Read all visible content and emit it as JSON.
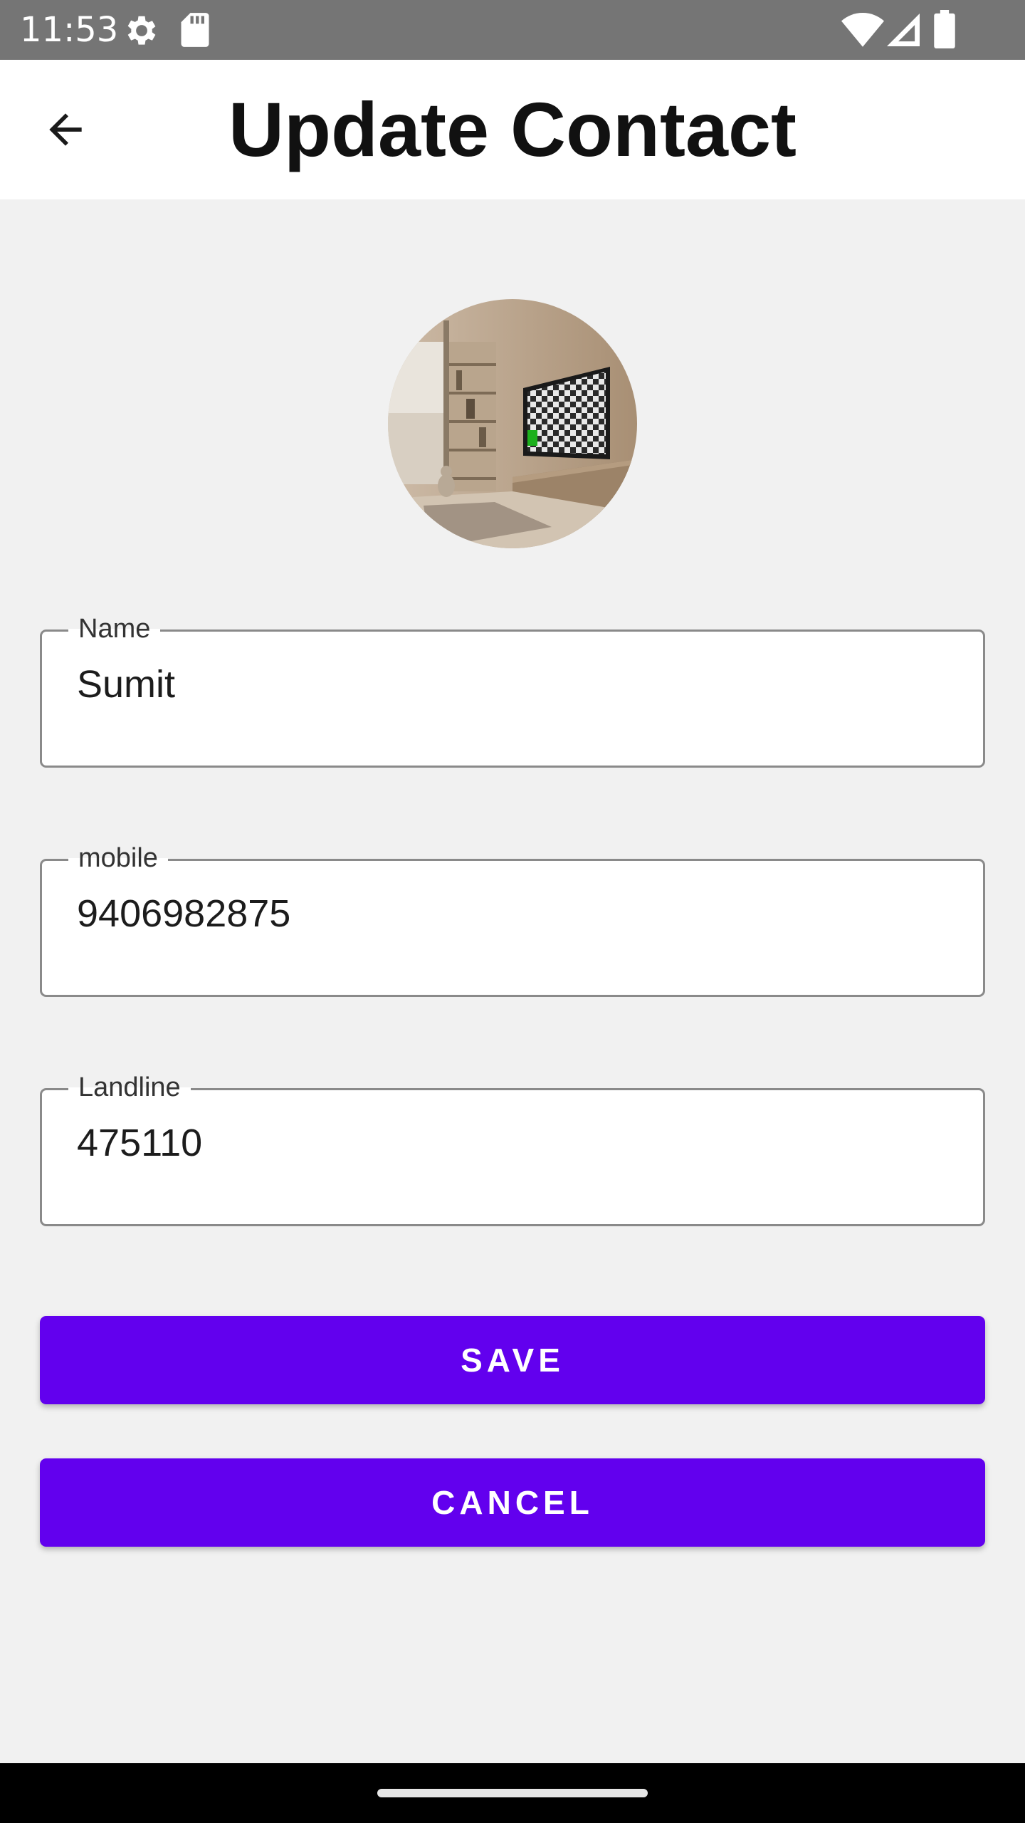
{
  "status_bar": {
    "time": "11:53",
    "icons": [
      "settings-icon",
      "sd-card-icon",
      "wifi-icon",
      "cell-signal-icon",
      "battery-icon"
    ]
  },
  "app_bar": {
    "title": "Update Contact",
    "back_icon": "arrow-back-icon"
  },
  "avatar": {
    "icon": "contact-photo"
  },
  "form": {
    "name": {
      "label": "Name",
      "value": "Sumit"
    },
    "mobile": {
      "label": "mobile",
      "value": "9406982875"
    },
    "landline": {
      "label": "Landline",
      "value": "475110"
    }
  },
  "actions": {
    "save_label": "SAVE",
    "cancel_label": "CANCEL"
  },
  "colors": {
    "accent": "#6200ee",
    "status_bar": "#757575",
    "background": "#f1f1f1"
  }
}
